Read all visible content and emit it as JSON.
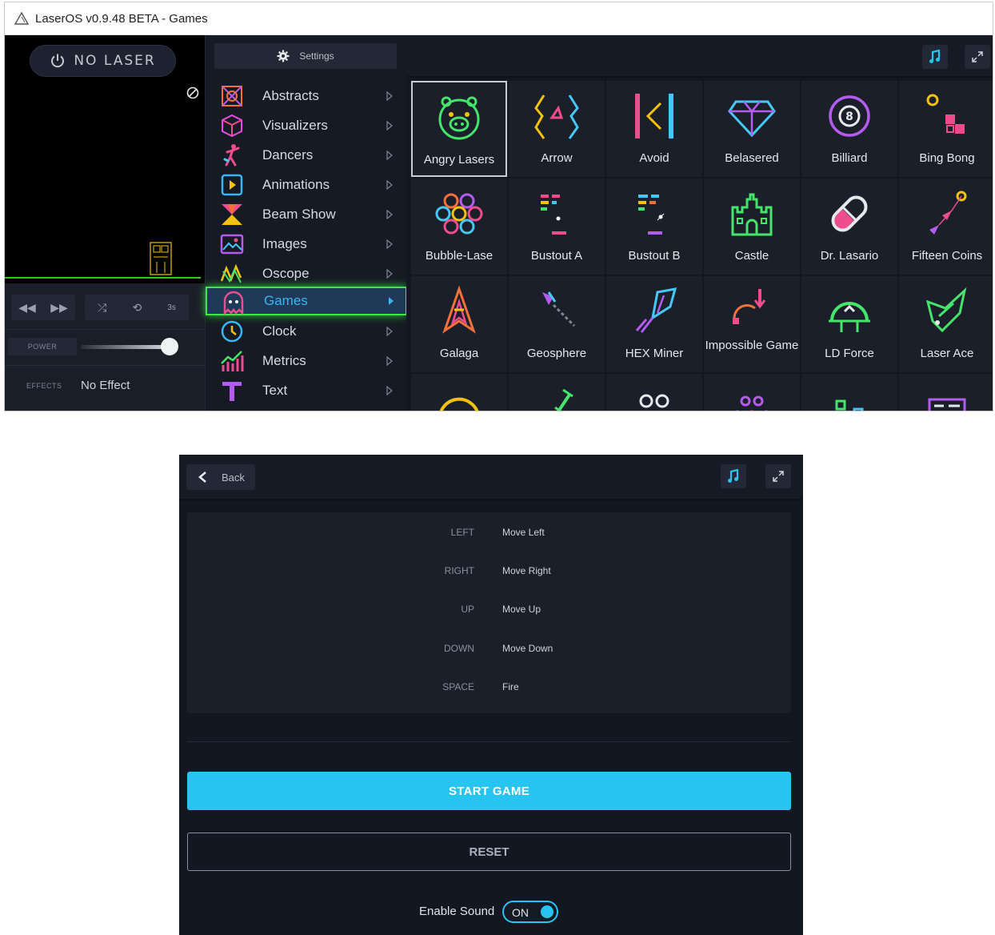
{
  "window": {
    "title": "LaserOS v0.9.48 BETA - Games"
  },
  "left_panel": {
    "no_laser_label": "NO LASER",
    "speed_label": "3s",
    "power_label": "POWER",
    "power_level": 0.9,
    "effects_label": "EFFECTS",
    "effects_value": "No Effect"
  },
  "menu": {
    "settings_label": "Settings",
    "items": [
      {
        "label": "Abstracts",
        "icon": "abstracts-icon"
      },
      {
        "label": "Visualizers",
        "icon": "visualizers-icon"
      },
      {
        "label": "Dancers",
        "icon": "dancers-icon"
      },
      {
        "label": "Animations",
        "icon": "animations-icon"
      },
      {
        "label": "Beam Show",
        "icon": "beam-show-icon"
      },
      {
        "label": "Images",
        "icon": "images-icon"
      },
      {
        "label": "Oscope",
        "icon": "oscope-icon"
      },
      {
        "label": "Games",
        "icon": "ghost-icon",
        "active": true
      },
      {
        "label": "Clock",
        "icon": "clock-icon"
      },
      {
        "label": "Metrics",
        "icon": "metrics-icon"
      },
      {
        "label": "Text",
        "icon": "text-icon"
      }
    ]
  },
  "games": [
    {
      "label": "Angry Lasers",
      "icon": "pig-icon",
      "selected": true
    },
    {
      "label": "Arrow",
      "icon": "arrow-game-icon"
    },
    {
      "label": "Avoid",
      "icon": "avoid-icon"
    },
    {
      "label": "Belasered",
      "icon": "diamond-icon"
    },
    {
      "label": "Billiard",
      "icon": "billiard-ball-icon"
    },
    {
      "label": "Bing Bong",
      "icon": "bing-bong-icon"
    },
    {
      "label": "Bubble-Lase",
      "icon": "bubbles-icon"
    },
    {
      "label": "Bustout A",
      "icon": "bustout-a-icon"
    },
    {
      "label": "Bustout B",
      "icon": "bustout-b-icon"
    },
    {
      "label": "Castle",
      "icon": "castle-icon"
    },
    {
      "label": "Dr. Lasario",
      "icon": "pill-icon"
    },
    {
      "label": "Fifteen Coins",
      "icon": "coins-icon"
    },
    {
      "label": "Galaga",
      "icon": "spaceship-icon"
    },
    {
      "label": "Geosphere",
      "icon": "geosphere-icon"
    },
    {
      "label": "HEX Miner",
      "icon": "hex-miner-icon"
    },
    {
      "label": "Impossible Game",
      "icon": "impossible-game-icon"
    },
    {
      "label": "LD Force",
      "icon": "ld-force-icon"
    },
    {
      "label": "Laser Ace",
      "icon": "laser-ace-icon"
    }
  ],
  "game_panel": {
    "back_label": "Back",
    "controls": [
      {
        "key": "LEFT",
        "action": "Move Left"
      },
      {
        "key": "RIGHT",
        "action": "Move Right"
      },
      {
        "key": "UP",
        "action": "Move Up"
      },
      {
        "key": "DOWN",
        "action": "Move Down"
      },
      {
        "key": "SPACE",
        "action": "Fire"
      }
    ],
    "start_label": "START GAME",
    "reset_label": "RESET",
    "sound_label": "Enable Sound",
    "sound_toggle": "ON"
  },
  "colors": {
    "accent": "#27c4f2",
    "active_glow": "#3ee64a",
    "panel_bg": "#131722"
  }
}
